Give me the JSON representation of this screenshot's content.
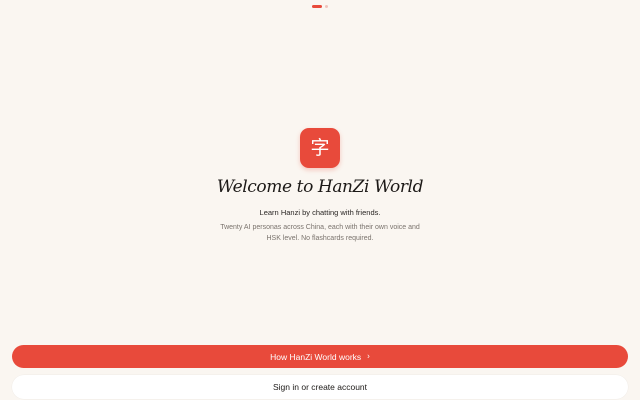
{
  "colors": {
    "accent": "#e84a3b",
    "dot_inactive": "#f0c3bc",
    "background": "#faf6f1"
  },
  "pagination": {
    "current": 1,
    "total": 2
  },
  "app_icon": {
    "glyph": "字"
  },
  "welcome": {
    "title": "Welcome to HanZi World",
    "subtitle": "Learn Hanzi by chatting with friends.",
    "description": "Twenty AI personas across China, each with their own voice and HSK level. No flashcards required."
  },
  "actions": {
    "primary_label": "How HanZi World works",
    "primary_icon": "chevron-right-icon",
    "secondary_label": "Sign in or create account"
  }
}
